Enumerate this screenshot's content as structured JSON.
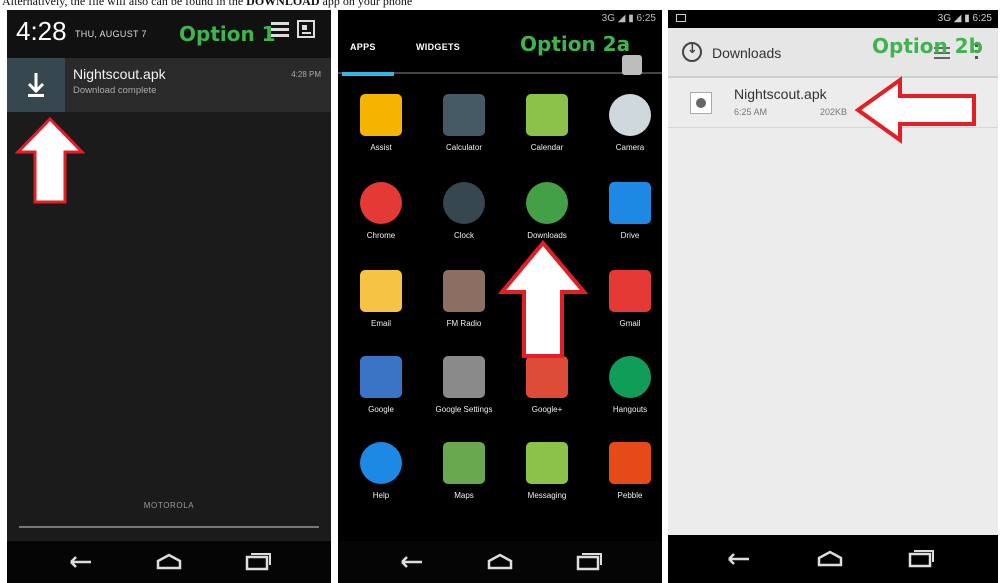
{
  "caption": {
    "before": "Alternatively, the file will also can be found in the ",
    "emphasis": "DOWNLOAD",
    "after": " app on your phone"
  },
  "labels": {
    "option1": "Option 1",
    "option2a": "Option 2a",
    "option2b": "Option 2b"
  },
  "panel1": {
    "time": "4:28",
    "date": "THU, AUGUST 7",
    "notification": {
      "title": "Nightscout.apk",
      "subtitle": "Download complete",
      "time": "4:28 PM"
    },
    "carrier": "MOTOROLA"
  },
  "panel2": {
    "status": "3G ◢ ▮ 6:25",
    "tabs": [
      "APPS",
      "WIDGETS"
    ],
    "apps": [
      {
        "label": "Assist",
        "icon": "assist-icon",
        "color": "#f5b400"
      },
      {
        "label": "Calculator",
        "icon": "calculator-icon",
        "color": "#455a64"
      },
      {
        "label": "Calendar",
        "icon": "calendar-icon",
        "color": "#8bc34a"
      },
      {
        "label": "Camera",
        "icon": "camera-icon",
        "color": "#cfd8dc"
      },
      {
        "label": "Chrome",
        "icon": "chrome-icon",
        "color": "#e53935"
      },
      {
        "label": "Clock",
        "icon": "clock-icon",
        "color": "#37474f"
      },
      {
        "label": "Downloads",
        "icon": "downloads-icon",
        "color": "#43a047"
      },
      {
        "label": "Drive",
        "icon": "drive-icon",
        "color": "#1e88e5"
      },
      {
        "label": "Email",
        "icon": "email-icon",
        "color": "#f6c343"
      },
      {
        "label": "FM Radio",
        "icon": "radio-icon",
        "color": "#8d6e63"
      },
      {
        "label": "",
        "icon": "",
        "color": ""
      },
      {
        "label": "Gmail",
        "icon": "gmail-icon",
        "color": "#e53935"
      },
      {
        "label": "Google",
        "icon": "google-icon",
        "color": "#3b73c5"
      },
      {
        "label": "Google Settings",
        "icon": "google-settings-icon",
        "color": "#8a8a8a"
      },
      {
        "label": "Google+",
        "icon": "google-plus-icon",
        "color": "#dd4b39"
      },
      {
        "label": "Hangouts",
        "icon": "hangouts-icon",
        "color": "#0f9d58"
      },
      {
        "label": "Help",
        "icon": "help-icon",
        "color": "#1e88e5"
      },
      {
        "label": "Maps",
        "icon": "maps-icon",
        "color": "#6aa84f"
      },
      {
        "label": "Messaging",
        "icon": "messaging-icon",
        "color": "#8bc34a"
      },
      {
        "label": "Pebble",
        "icon": "pebble-icon",
        "color": "#e64a19"
      }
    ]
  },
  "panel3": {
    "status": "3G ◢ ▮ 6:25",
    "title": "Downloads",
    "item": {
      "name": "Nightscout.apk",
      "time": "6:25 AM",
      "size": "202KB"
    }
  },
  "colors": {
    "label_green": "#3fb34f",
    "arrow_red": "#e31e24"
  }
}
